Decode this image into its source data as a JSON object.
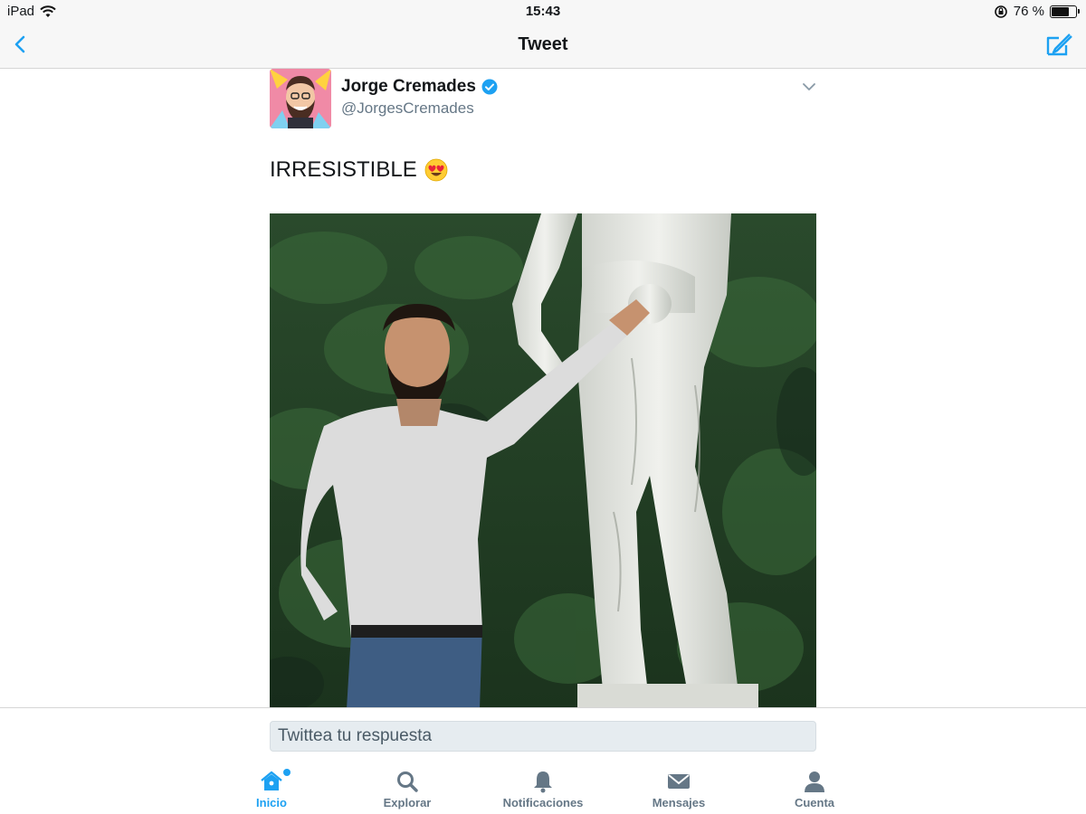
{
  "status_bar": {
    "device": "iPad",
    "time": "15:43",
    "battery_percent": "76 %",
    "battery_level": 0.76
  },
  "nav": {
    "title": "Tweet",
    "back_icon": "chevron-left-icon",
    "compose_icon": "compose-tweet-icon"
  },
  "tweet": {
    "author_name": "Jorge Cremades",
    "author_handle": "@JorgesCremades",
    "verified": true,
    "text": "IRRESISTIBLE",
    "text_emoji": "heart-eyes-emoji",
    "media_type": "video"
  },
  "reply": {
    "placeholder": "Twittea tu respuesta"
  },
  "tabs": [
    {
      "label": "Inicio",
      "icon": "home-icon",
      "active": true
    },
    {
      "label": "Explorar",
      "icon": "search-icon",
      "active": false
    },
    {
      "label": "Notificaciones",
      "icon": "bell-icon",
      "active": false
    },
    {
      "label": "Mensajes",
      "icon": "envelope-icon",
      "active": false
    },
    {
      "label": "Cuenta",
      "icon": "person-icon",
      "active": false
    }
  ],
  "colors": {
    "accent": "#1da1f2",
    "text_secondary": "#657786"
  }
}
